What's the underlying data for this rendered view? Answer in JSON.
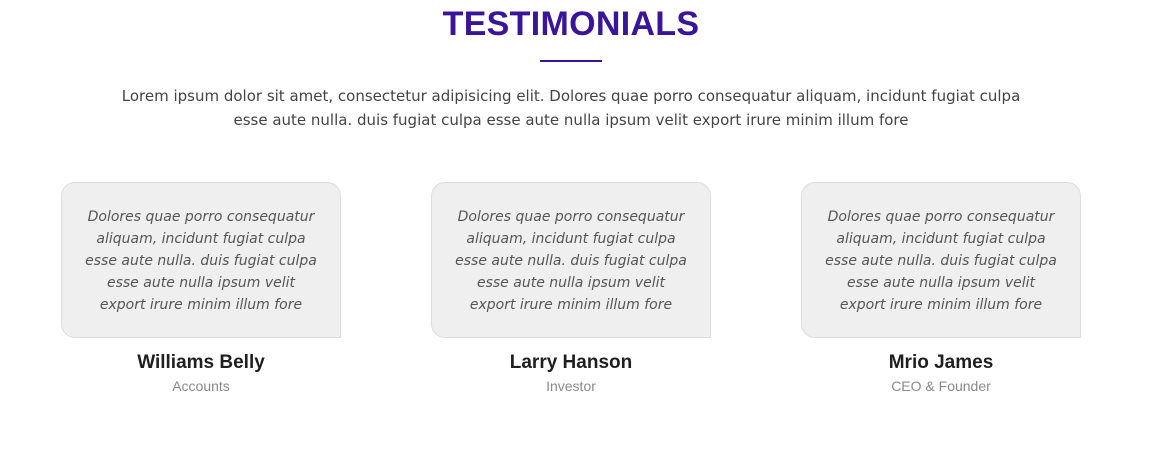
{
  "section": {
    "title": "TESTIMONIALS",
    "intro": "Lorem ipsum dolor sit amet, consectetur adipisicing elit. Dolores quae porro consequatur aliquam, incidunt fugiat culpa esse aute nulla. duis fugiat culpa esse aute nulla ipsum velit export irure minim illum fore",
    "accent_color": "#3a1599"
  },
  "testimonials": [
    {
      "quote": "Dolores quae porro consequatur aliquam, incidunt fugiat culpa esse aute nulla. duis fugiat culpa esse aute nulla ipsum velit export irure minim illum fore",
      "name": "Williams Belly",
      "role": "Accounts"
    },
    {
      "quote": "Dolores quae porro consequatur aliquam, incidunt fugiat culpa esse aute nulla. duis fugiat culpa esse aute nulla ipsum velit export irure minim illum fore",
      "name": "Larry Hanson",
      "role": "Investor"
    },
    {
      "quote": "Dolores quae porro consequatur aliquam, incidunt fugiat culpa esse aute nulla. duis fugiat culpa esse aute nulla ipsum velit export irure minim illum fore",
      "name": "Mrio James",
      "role": "CEO & Founder"
    }
  ]
}
